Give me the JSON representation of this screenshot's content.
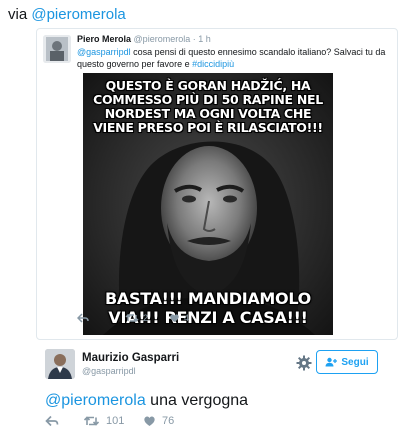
{
  "header": {
    "via_prefix": "via ",
    "via_mention": "@pieromerola"
  },
  "quoted_tweet": {
    "author_name": "Piero Merola",
    "author_handle": "@pieromerola",
    "time": "· 1 h",
    "text_mention": "@gasparripdl",
    "text_body": " cosa pensi di questo ennesimo scandalo italiano? Salvaci tu da questo governo per favore e ",
    "text_hashtag": "#diccidipiù",
    "meme_top": "QUESTO È GORAN HADŽIĆ, HA COMMESSO PIÙ DI 50 RAPINE NEL NORDEST MA OGNI VOLTA CHE VIENE PRESO POI È RILASCIATO!!!",
    "meme_bottom": "BASTA!!! MANDIAMOLO VIA!!! RENZI A CASA!!!",
    "retweets": "2",
    "likes": "4",
    "icons": [
      "reply-icon",
      "retweet-icon",
      "like-icon"
    ]
  },
  "main_tweet": {
    "author_name": "Maurizio Gasparri",
    "author_handle": "@gasparripdl",
    "follow_label": "Segui",
    "text_mention": "@pieromerola",
    "text_body": " una vergogna",
    "retweets": "101",
    "likes": "76",
    "icons": [
      "gear-icon",
      "follow-user-icon",
      "reply-icon",
      "retweet-icon",
      "like-icon"
    ]
  },
  "colors": {
    "link": "#1b95e0",
    "follow_button": "#1da1f2",
    "muted": "#8899a6"
  }
}
